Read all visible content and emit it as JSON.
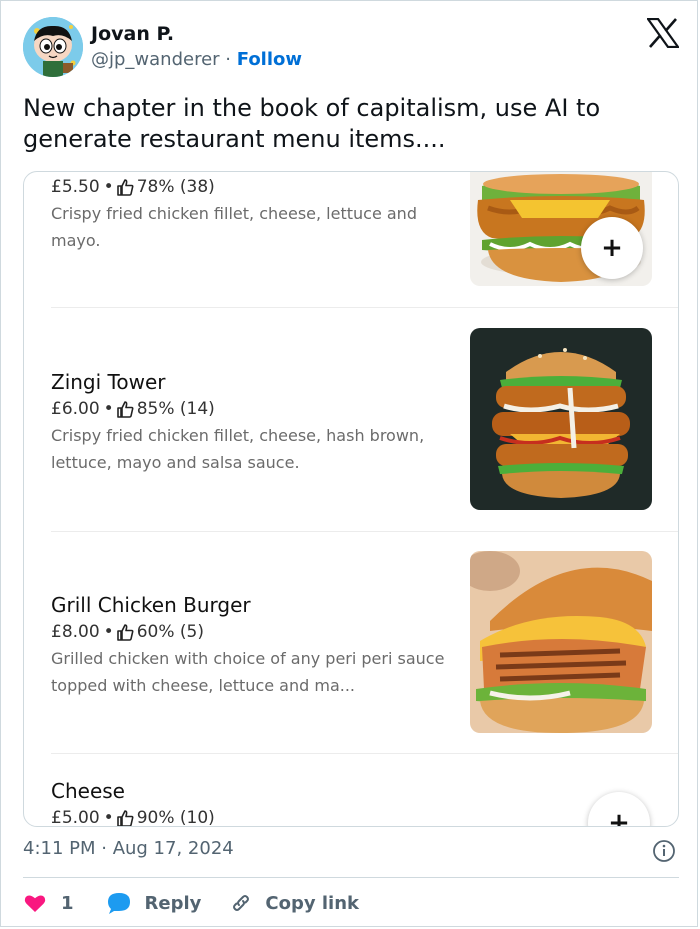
{
  "user": {
    "name": "Jovan P.",
    "handle": "@jp_wanderer",
    "separator": " · ",
    "follow_label": "Follow"
  },
  "tweet": {
    "text": "New chapter in the book of capitalism,  use AI to generate restaurant menu items...."
  },
  "menu": {
    "items": [
      {
        "title": "",
        "price": "£5.50",
        "rating": "78% (38)",
        "description": "Crispy fried chicken fillet, cheese, lettuce and mayo.",
        "add_label": "+"
      },
      {
        "title": "Zingi Tower",
        "price": "£6.00",
        "rating": "85% (14)",
        "description": "Crispy fried chicken fillet, cheese, hash brown, lettuce, mayo and salsa sauce.",
        "add_label": "+"
      },
      {
        "title": "Grill Chicken Burger",
        "price": "£8.00",
        "rating": "60% (5)",
        "description": "Grilled chicken with choice of any peri peri sauce topped with cheese, lettuce and ma...",
        "add_label": "+"
      },
      {
        "title": "Cheese",
        "price": "£5.00",
        "rating": "90% (10)",
        "description": "",
        "add_label": "+"
      }
    ],
    "dot": "•"
  },
  "footer": {
    "timestamp": "4:11 PM · Aug 17, 2024",
    "like_count": "1",
    "reply_label": "Reply",
    "copy_label": "Copy link"
  },
  "colors": {
    "like": "#f91880",
    "reply": "#1d9bf0",
    "follow": "#006fd6"
  },
  "icons": [
    "x-logo-icon",
    "info-icon",
    "heart-icon",
    "reply-bubble-icon",
    "link-icon",
    "thumbs-up-icon",
    "plus-icon"
  ]
}
